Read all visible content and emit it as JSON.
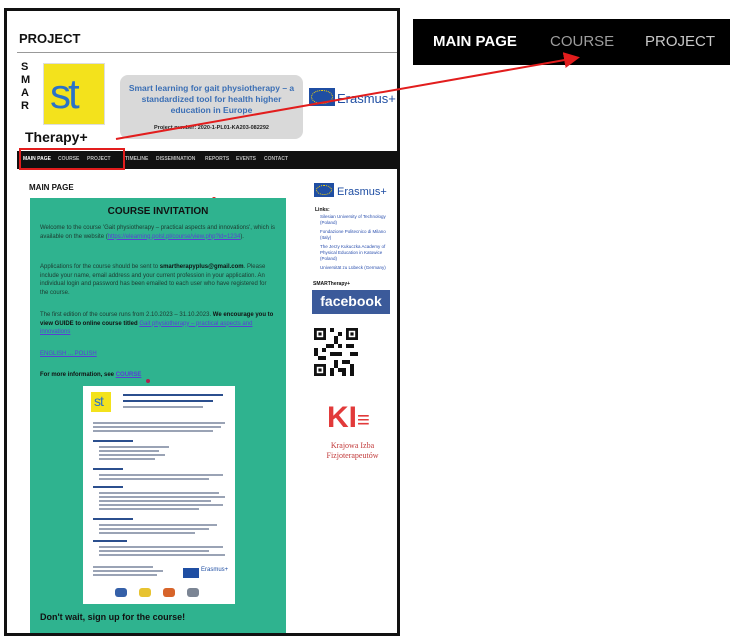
{
  "left_panel": {
    "page_title": "PROJECT",
    "logo": {
      "smar": [
        "S",
        "M",
        "A",
        "R"
      ],
      "st": "st",
      "therapy": "Therapy+"
    },
    "project_box": {
      "description": "Smart learning for gait physiotherapy – a standardized tool for health higher education in Europe",
      "number": "Project number: 2020-1-PL01-KA203-082292"
    },
    "erasmus_label": "Erasmus+",
    "nav": [
      "MAIN PAGE",
      "COURSE",
      "PROJECT",
      "TIMELINE",
      "DISSEMINATION",
      "REPORTS",
      "EVENTS",
      "CONTACT"
    ],
    "main_heading": "MAIN PAGE",
    "invitation": {
      "title": "COURSE INVITATION",
      "para1_a": "Welcome to the course 'Gait physiotherapy – practical aspects and innovations', which is available on the website (",
      "para1_link": "https://elearning.polsl.pl/course/view.php?id=1234",
      "para1_b": ").",
      "para2_a": "Applications for the course should be sent to ",
      "para2_email": "smartherapyplus@gmail.com",
      "para2_b": ". Please include your name, email address and your current profession in your application. An individual login and password has been emailed to each user who have registered for the course.",
      "para3_a": "The first edition of the course runs from 2.10.2023 – 31.10.2023. ",
      "para3_b": "We encourage you to view GUIDE to online course titled ",
      "para3_link": "Gait physiotherapy – practical aspects and innovations",
      "para4": "ENGLISH   ...   POLISH",
      "more_info_label": "For more information, see ",
      "more_info_link": "COURSE",
      "signup": "Don't wait, sign up for the course!"
    },
    "sidebar": {
      "erasmus_label": "Erasmus+",
      "links_title": "Links:",
      "links": [
        "Silesian University of Technology (Poland)",
        "Fondazione Politecnico di Milano (Italy)",
        "The Jerzy Kukuczka Academy of Physical Education in Katowice (Poland)",
        "Universität zu Lübeck (Germany)"
      ],
      "smar_label": "SMARTherapy+",
      "facebook": "facebook",
      "kif_mark": "KI",
      "kif_name": "Krajowa Izba Fizjoterapeutów"
    }
  },
  "zoomed_nav": {
    "items": [
      "MAIN PAGE",
      "COURSE",
      "PROJECT"
    ]
  },
  "colors": {
    "nav_bg": "#000000",
    "highlight": "#e21d1d",
    "invitation_bg": "#2fb38f",
    "st_logo": "#f3e21c",
    "facebook": "#3b5a9a",
    "kif": "#e23a3a"
  }
}
